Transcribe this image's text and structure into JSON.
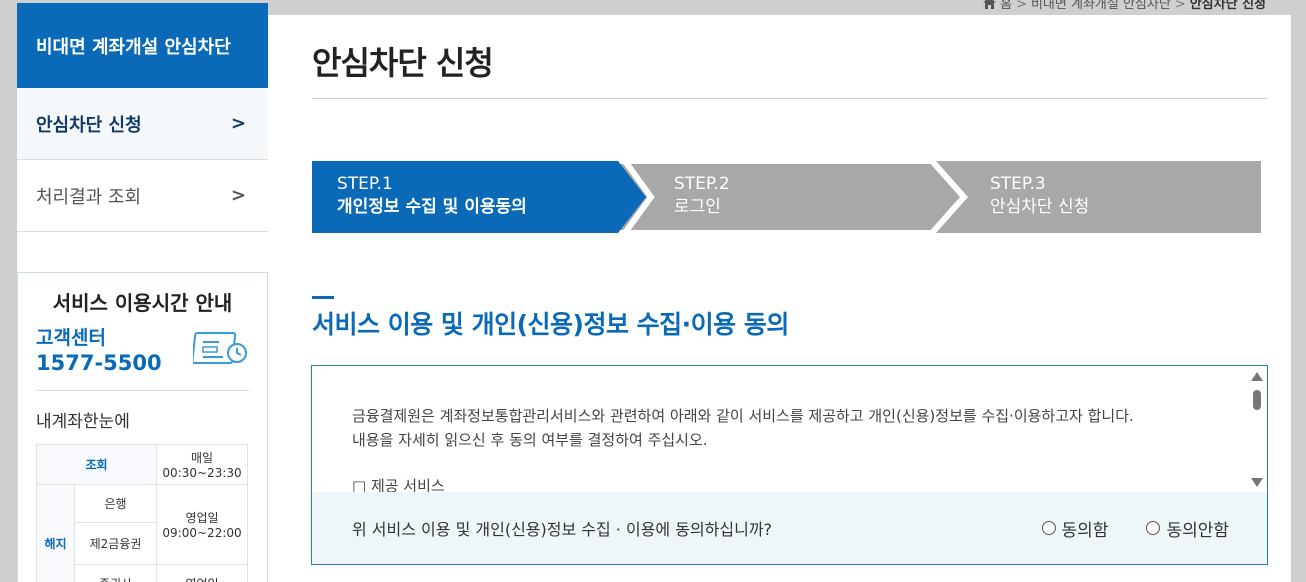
{
  "breadcrumb": {
    "home": "홈",
    "items": [
      "비대면 계좌개설 안심차단",
      "안심차단 신청"
    ]
  },
  "sidebar": {
    "header": "비대면 계좌개설 안심차단",
    "items": [
      {
        "label": "안심차단 신청",
        "active": true
      },
      {
        "label": "처리결과 조회",
        "active": false
      }
    ]
  },
  "service_hours": {
    "title": "서비스 이용시간 안내",
    "cs_label": "고객센터",
    "cs_number": "1577-5500",
    "icon": "calendar-clock-icon",
    "subtitle": "내계좌한눈에",
    "rows": {
      "inquiry": {
        "label": "조회",
        "when": "매일",
        "time": "00:30~23:30"
      },
      "cancel_label": "해지",
      "bank": {
        "label": "은행",
        "when": "영업일",
        "time": "09:00~22:00"
      },
      "fin2": {
        "label": "제2금융권"
      },
      "sec": {
        "label": "증권사",
        "when": "영업일"
      }
    }
  },
  "main": {
    "title": "안심차단 신청",
    "steps": [
      {
        "num": "STEP.1",
        "label": "개인정보 수집 및 이용동의",
        "active": true
      },
      {
        "num": "STEP.2",
        "label": "로그인",
        "active": false
      },
      {
        "num": "STEP.3",
        "label": "안심차단 신청",
        "active": false
      }
    ],
    "section_title": "서비스 이용 및 개인(신용)정보 수집·이용 동의",
    "terms": {
      "line1": "금융결제원은 계좌정보통합관리서비스와 관련하여 아래와 같이 서비스를 제공하고 개인(신용)정보를 수집·이용하고자 합니다.",
      "line2": "내용을 자세히 읽으신 후 동의 여부를 결정하여 주십시오.",
      "line3": "□ 제공 서비스"
    },
    "agree": {
      "question": "위 서비스 이용 및 개인(신용)정보 수집 · 이용에 동의하십니까?",
      "yes": "동의함",
      "no": "동의안함"
    }
  },
  "colors": {
    "brand": "#0b6ab7",
    "step_inactive": "#a8a8a8",
    "border_teal": "#2a7fa3"
  }
}
